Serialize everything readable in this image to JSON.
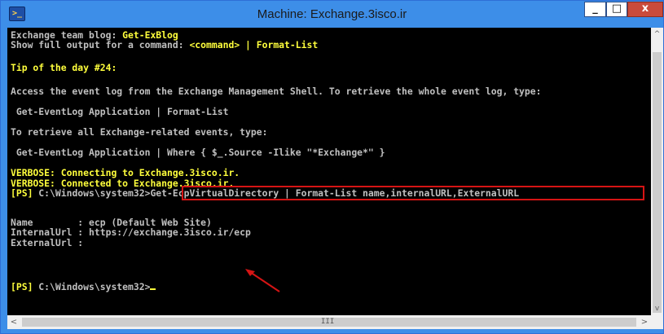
{
  "window": {
    "title": "Machine: Exchange.3isco.ir",
    "app_icon": "powershell-icon",
    "buttons": {
      "minimize": "_",
      "maximize": "□",
      "close": "x"
    }
  },
  "console": {
    "lines": [
      {
        "parts": [
          "Exchange team blog: ",
          "Get-ExBlog"
        ]
      },
      {
        "parts": [
          "Show full output for a command: ",
          "<command> | Format-List"
        ]
      },
      {
        "parts": [
          "Tip of the day #24:"
        ]
      },
      {
        "parts": [
          "Access the event log from the Exchange Management Shell. To retrieve the whole event log, type:"
        ]
      },
      {
        "parts": [
          " Get-EventLog Application | Format-List"
        ]
      },
      {
        "parts": [
          "To retrieve all Exchange-related events, type:"
        ]
      },
      {
        "parts": [
          " Get-EventLog Application | Where { $_.Source -Ilike \"*Exchange*\" }"
        ]
      },
      {
        "parts": [
          "VERBOSE: Connecting to Exchange.3isco.ir."
        ]
      },
      {
        "parts": [
          "VERBOSE: Connected to Exchange.3isco.ir."
        ]
      },
      {
        "parts": [
          "[PS]",
          " C:\\Windows\\system32>",
          "Get-EcpVirtualDirectory | Format-List name,internalURL,ExternalURL"
        ]
      },
      {
        "parts": [
          "Name        : ecp (Default Web Site)"
        ]
      },
      {
        "parts": [
          "InternalUrl : https://exchange.3isco.ir/ecp"
        ]
      },
      {
        "parts": [
          "ExternalUrl :"
        ]
      },
      {
        "parts": [
          "[PS]",
          " C:\\Windows\\system32>"
        ]
      }
    ]
  },
  "scrollbars": {
    "vertical": {
      "up": "^",
      "down": "v"
    },
    "horizontal": {
      "left": "<",
      "right": ">",
      "grip": "III"
    }
  },
  "annotations": {
    "highlight_color": "#d51414",
    "arrow_color": "#d51414"
  },
  "colors": {
    "console_bg": "#000000",
    "text_gray": "#c0c0c0",
    "text_yellow": "#ffff3c",
    "text_red": "#ff3b3b",
    "title_bar": "#3d8ee8"
  }
}
